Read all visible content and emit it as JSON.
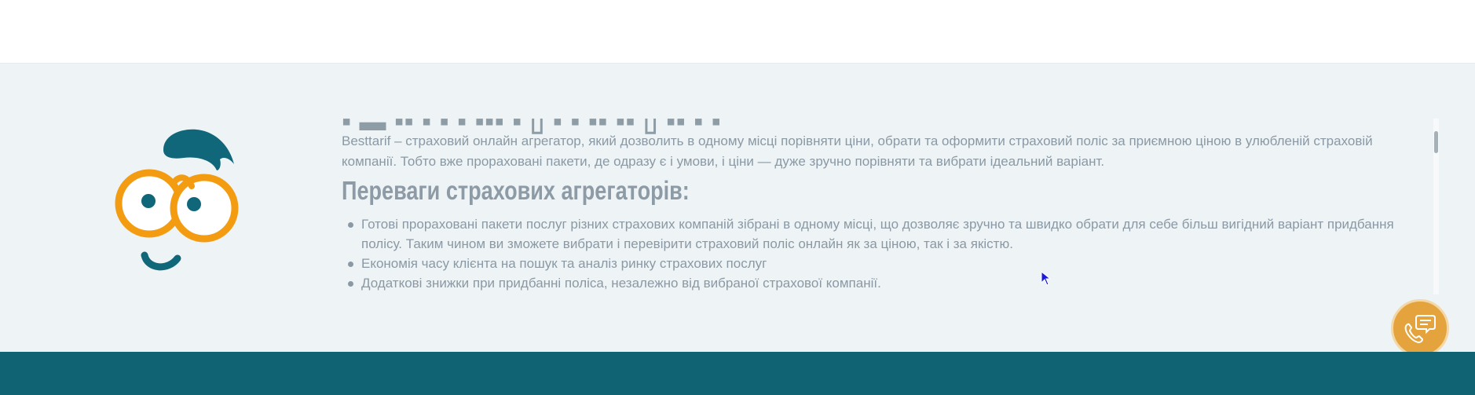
{
  "seo": {
    "intro": "Besttarif – страховий онлайн агрегатор, який дозволить в одному місці порівняти ціни, обрати та оформити страховий поліс за приємною ціною в улюбленій страховій компанії. Тобто вже прораховані пакети, де одразу є і умови, і ціни — дуже зручно порівняти та вибрати ідеальний варіант.",
    "benefits_heading": "Переваги страхових агрегаторів:",
    "benefits": [
      "Готові прораховані пакети послуг різних страхових компаній зібрані в одному місці, що дозволяє зручно та швидко обрати для себе більш вигідний варіант придбання полісу. Таким чином ви зможете вибрати і перевірити страховий поліс онлайн як за ціною, так і за якістю.",
      "Економія часу клієнта на пошук та аналіз ринку страхових послуг",
      "Додаткові знижки при придбанні поліса, незалежно від вибраної страхової компанії."
    ]
  },
  "colors": {
    "section_bg": "#eef3f5",
    "text": "#8a99a4",
    "mascot_teal": "#10677a",
    "mascot_orange": "#f39c12",
    "callback_orange": "#e4a33c",
    "footer_teal": "#0f6373"
  },
  "icons": {
    "mascot": "nerd-face-logo",
    "callback": "phone-chat-icon",
    "cursor": "mouse-pointer-icon"
  }
}
